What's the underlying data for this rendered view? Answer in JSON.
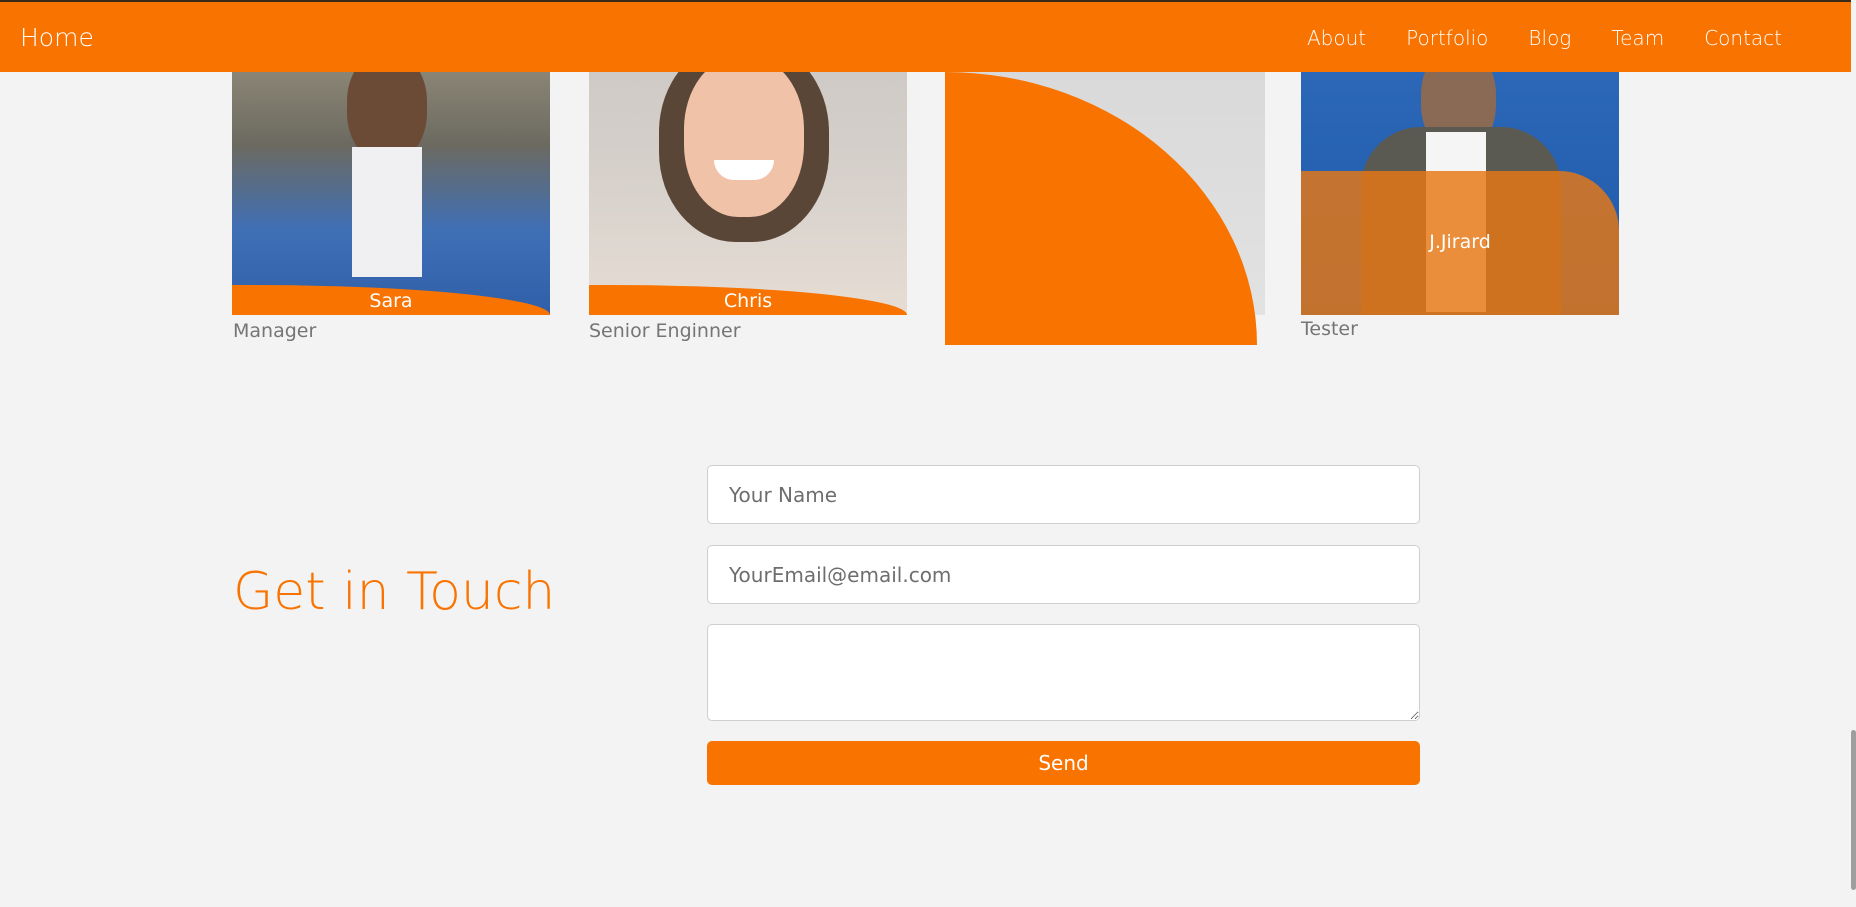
{
  "navbar": {
    "brand": "Home",
    "links": [
      "About",
      "Portfolio",
      "Blog",
      "Team",
      "Contact"
    ]
  },
  "team": {
    "members": [
      {
        "name": "Sara",
        "role": "Manager"
      },
      {
        "name": "Chris",
        "role": "Senior Enginner"
      },
      {
        "name": "",
        "role": ""
      },
      {
        "name": "J.Jirard",
        "role": "Tester"
      }
    ]
  },
  "contact": {
    "title": "Get in Touch",
    "name_placeholder": "Your Name",
    "email_placeholder": "YourEmail@email.com",
    "message_placeholder": "",
    "send_label": "Send"
  },
  "colors": {
    "accent": "#f97300",
    "background": "#f3f3f3"
  }
}
